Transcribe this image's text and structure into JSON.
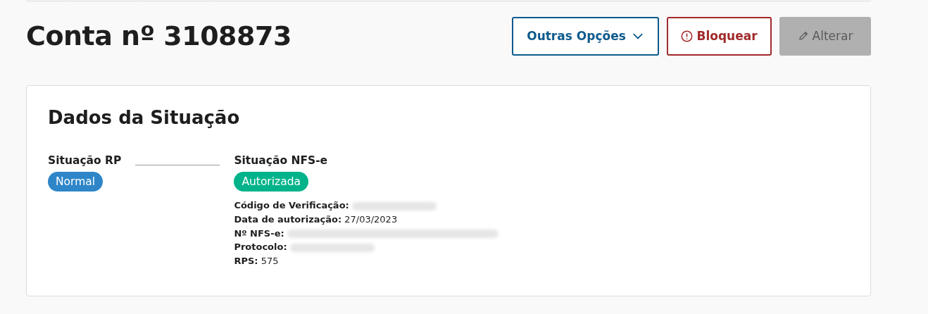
{
  "title": "Conta nº 3108873",
  "actions": [
    {
      "label": "Outras Opções",
      "kind": "menu",
      "disabled": false
    },
    {
      "label": "Bloquear",
      "kind": "danger",
      "disabled": false
    },
    {
      "label": "Alterar",
      "kind": "edit",
      "disabled": true
    }
  ],
  "card": {
    "title": "Dados da Situação",
    "statuses": [
      {
        "label": "Situação RP",
        "badge": "Normal",
        "color": "#2e86c9"
      },
      {
        "label": "Situação NFS-e",
        "badge": "Autorizada",
        "color": "#00b38a"
      }
    ],
    "details": [
      {
        "label": "Código de Verificação:",
        "redacted": true
      },
      {
        "label": "Data de autorização:",
        "value": "27/03/2023",
        "redacted": false
      },
      {
        "label": "Nº NFS-e:",
        "redacted": true
      },
      {
        "label": "Protocolo:",
        "redacted": true
      },
      {
        "label": "RPS:",
        "value": "575",
        "redacted": false
      }
    ]
  }
}
